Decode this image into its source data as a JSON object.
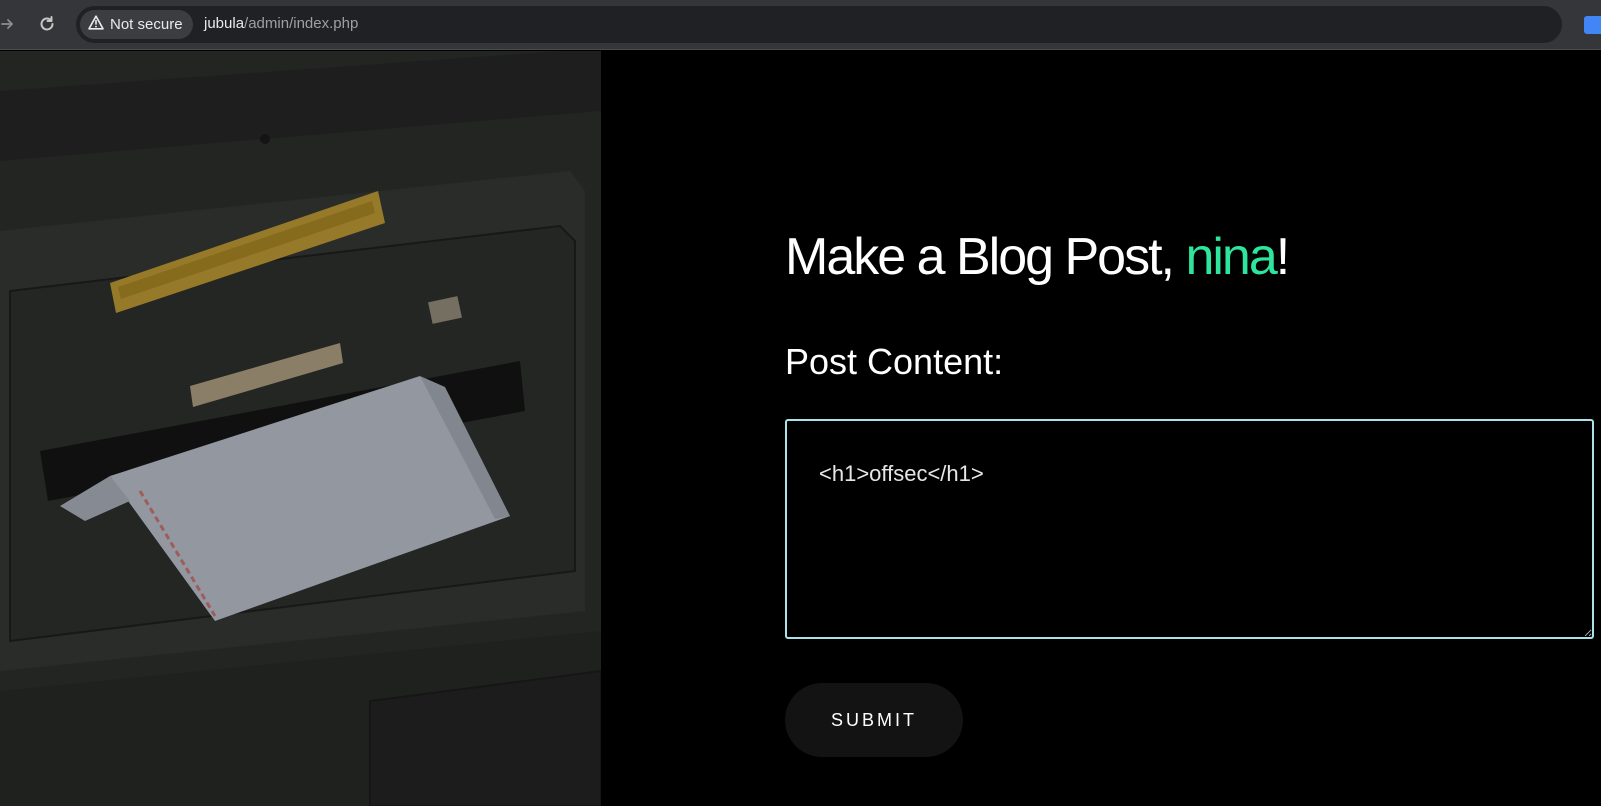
{
  "browser": {
    "security_label": "Not secure",
    "url_host": "jubula",
    "url_path": "/admin/index.php"
  },
  "page": {
    "headline_prefix": "Make a Blog Post, ",
    "username": "nina",
    "headline_suffix": "!",
    "field_label": "Post Content:",
    "post_content": "<h1>offsec</h1>",
    "submit_label": "SUBMIT"
  },
  "colors": {
    "accent": "#2ee59d",
    "textarea_border": "#a9e3e8",
    "page_background": "#000000",
    "button_background": "#131313"
  },
  "icons": [
    "forward-arrow-icon",
    "reload-icon",
    "warning-icon",
    "star-icon",
    "extension-icon"
  ]
}
